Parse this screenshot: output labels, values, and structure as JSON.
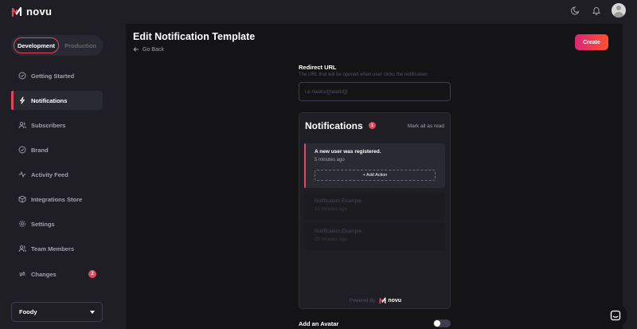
{
  "brand": {
    "name": "novu",
    "accent": "#e3475e"
  },
  "header": {
    "icons": [
      "moon-icon",
      "bell-icon",
      "avatar"
    ]
  },
  "environment": {
    "options": [
      "Development",
      "Production"
    ],
    "selected": "Development"
  },
  "sidebar": {
    "items": [
      {
        "label": "Getting Started",
        "icon": "check-circle-icon"
      },
      {
        "label": "Notifications",
        "icon": "bolt-icon",
        "active": true
      },
      {
        "label": "Subscribers",
        "icon": "users-icon"
      },
      {
        "label": "Brand",
        "icon": "check-circle-icon"
      },
      {
        "label": "Activity Feed",
        "icon": "activity-icon"
      },
      {
        "label": "Integrations Store",
        "icon": "box-icon"
      },
      {
        "label": "Settings",
        "icon": "gear-icon"
      },
      {
        "label": "Team Members",
        "icon": "users-icon"
      },
      {
        "label": "Changes",
        "icon": "sync-icon",
        "badge": "2"
      }
    ],
    "organization": "Foody"
  },
  "page": {
    "title": "Edit Notification Template",
    "back_label": "Go Back",
    "create_label": "Create"
  },
  "redirect": {
    "label": "Redirect URL",
    "description": "The URL that will be opened when user clicks the notification",
    "placeholder": "i.e /tasks/{{taskId}}"
  },
  "preview": {
    "title": "Notifications",
    "count": "1",
    "mark_all": "Mark all as read",
    "items": [
      {
        "title": "A new user was registered.",
        "time": "5 minutes ago",
        "action": "+ Add Action",
        "unread": true
      },
      {
        "title": "Notification Example",
        "time": "10 minutes ago",
        "unread": false
      },
      {
        "title": "Notification Example",
        "time": "25 minutes ago",
        "unread": false
      }
    ],
    "powered_by": "Powered By",
    "powered_brand": "novu"
  },
  "avatar_toggle": {
    "label": "Add an Avatar",
    "enabled": false
  }
}
